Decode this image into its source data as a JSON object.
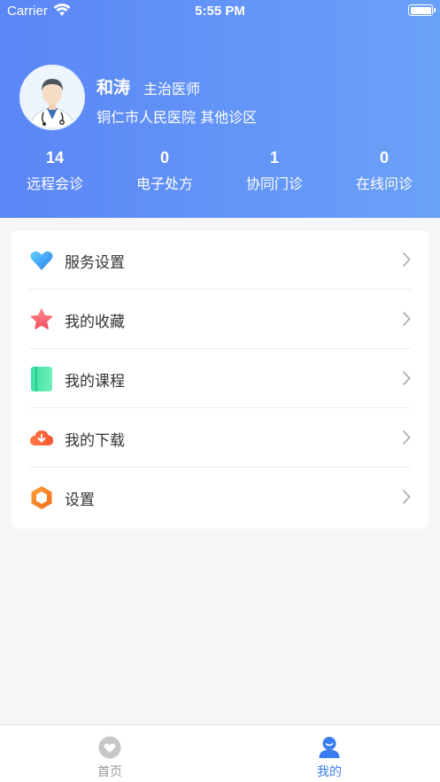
{
  "status_bar": {
    "carrier": "Carrier",
    "time": "5:55 PM"
  },
  "profile": {
    "name": "和涛",
    "title": "主治医师",
    "hospital": "铜仁市人民医院  其他诊区"
  },
  "stats": [
    {
      "value": "14",
      "label": "远程会诊"
    },
    {
      "value": "0",
      "label": "电子处方"
    },
    {
      "value": "1",
      "label": "协同门诊"
    },
    {
      "value": "0",
      "label": "在线问诊"
    }
  ],
  "menu": [
    {
      "label": "服务设置",
      "icon": "heart-icon"
    },
    {
      "label": "我的收藏",
      "icon": "star-icon"
    },
    {
      "label": "我的课程",
      "icon": "book-icon"
    },
    {
      "label": "我的下载",
      "icon": "cloud-download-icon"
    },
    {
      "label": "设置",
      "icon": "hexagon-settings-icon"
    }
  ],
  "tabbar": {
    "home": "首页",
    "mine": "我的"
  },
  "colors": {
    "header_start": "#5b86f6",
    "header_end": "#6aa1f8",
    "active_tab": "#3b7cf0",
    "inactive_tab": "#999999"
  }
}
